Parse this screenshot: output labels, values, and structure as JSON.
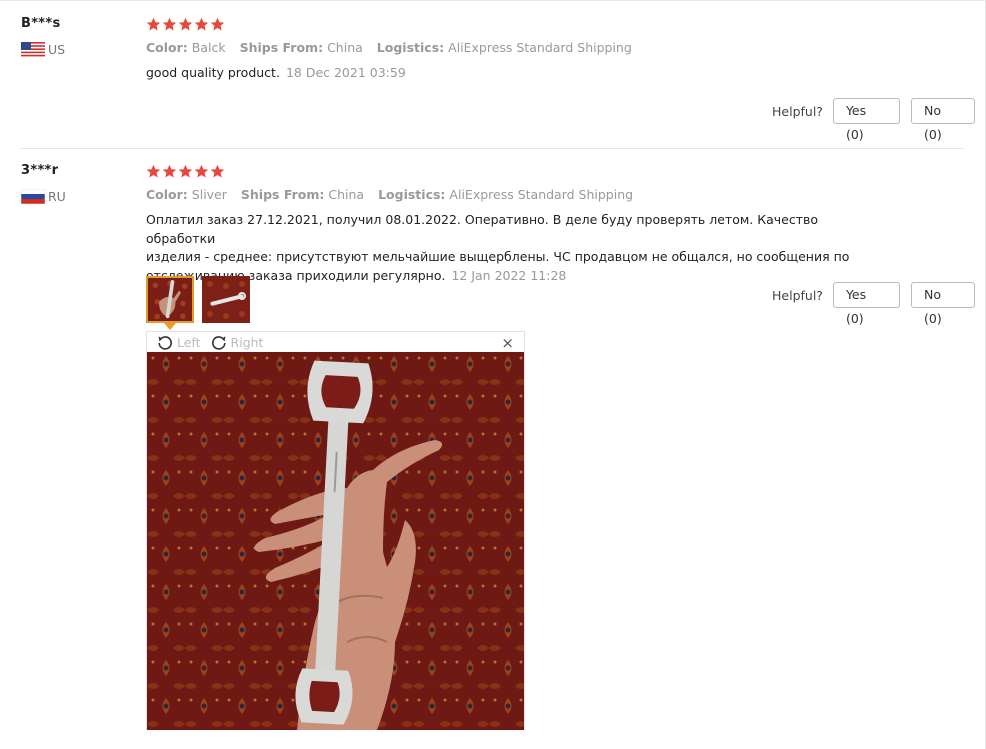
{
  "reviews": [
    {
      "user": "B***s",
      "country": "US",
      "rating": 5,
      "meta": {
        "color_label": "Color:",
        "color": "Balck",
        "ships_label": "Ships From:",
        "ships": "China",
        "logistics_label": "Logistics:",
        "logistics": "AliExpress Standard Shipping"
      },
      "text": "good quality product.",
      "date": "18 Dec 2021 03:59",
      "helpful_label": "Helpful?",
      "yes_label": "Yes (0)",
      "no_label": "No (0)"
    },
    {
      "user": "3***r",
      "country": "RU",
      "rating": 5,
      "meta": {
        "color_label": "Color:",
        "color": "Sliver",
        "ships_label": "Ships From:",
        "ships": "China",
        "logistics_label": "Logistics:",
        "logistics": "AliExpress Standard Shipping"
      },
      "text_line1": "Оплатил заказ 27.12.2021, получил 08.01.2022. Оперативно. В деле буду проверять летом. Качество обработки",
      "text_line2": "изделия - среднее: присутствуют мельчайшие выщерблены. ЧС продавцом не общался, но сообщения по",
      "text_line3": "отслеживанию заказа приходили регулярно.",
      "date": "12 Jan 2022 11:28",
      "helpful_label": "Helpful?",
      "yes_label": "Yes (0)",
      "no_label": "No (0)"
    }
  ],
  "viewer": {
    "rotate_left": "Left",
    "rotate_right": "Right",
    "close": "×"
  },
  "colors": {
    "star": "#e8483d",
    "accent": "#f0972e",
    "muted": "#999999"
  }
}
